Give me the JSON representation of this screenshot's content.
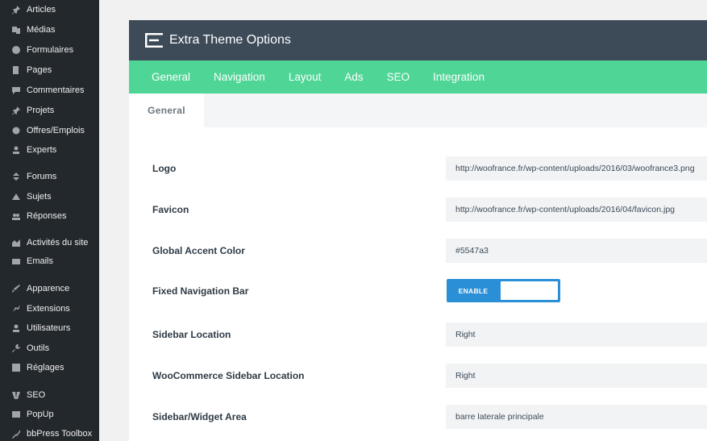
{
  "sidebar": {
    "items": [
      {
        "label": "Articles",
        "icon": "pin-icon"
      },
      {
        "label": "Médias",
        "icon": "media-icon"
      },
      {
        "label": "Formulaires",
        "icon": "form-icon"
      },
      {
        "label": "Pages",
        "icon": "page-icon"
      },
      {
        "label": "Commentaires",
        "icon": "comment-icon"
      },
      {
        "label": "Projets",
        "icon": "pin-icon"
      },
      {
        "label": "Offres/Emplois",
        "icon": "briefcase-icon"
      },
      {
        "label": "Experts",
        "icon": "user-icon"
      },
      {
        "label": "Forums",
        "icon": "forum-icon"
      },
      {
        "label": "Sujets",
        "icon": "topic-icon"
      },
      {
        "label": "Réponses",
        "icon": "reply-icon"
      },
      {
        "label": "Activités du site",
        "icon": "activity-icon"
      },
      {
        "label": "Emails",
        "icon": "email-icon"
      },
      {
        "label": "Apparence",
        "icon": "brush-icon"
      },
      {
        "label": "Extensions",
        "icon": "plugin-icon"
      },
      {
        "label": "Utilisateurs",
        "icon": "users-icon"
      },
      {
        "label": "Outils",
        "icon": "wrench-icon"
      },
      {
        "label": "Réglages",
        "icon": "settings-icon"
      },
      {
        "label": "SEO",
        "icon": "seo-icon"
      },
      {
        "label": "PopUp",
        "icon": "popup-icon"
      },
      {
        "label": "bbPress Toolbox",
        "icon": "toolbox-icon"
      }
    ]
  },
  "header": {
    "title": "Extra Theme Options"
  },
  "tabs": [
    "General",
    "Navigation",
    "Layout",
    "Ads",
    "SEO",
    "Integration"
  ],
  "subtab": "General",
  "settings": [
    {
      "label": "Logo",
      "value": "http://woofrance.fr/wp-content/uploads/2016/03/woofrance3.png"
    },
    {
      "label": "Favicon",
      "value": "http://woofrance.fr/wp-content/uploads/2016/04/favicon.jpg"
    },
    {
      "label": "Global Accent Color",
      "value": "#5547a3"
    },
    {
      "label": "Fixed Navigation Bar",
      "toggle": "ENABLE"
    },
    {
      "label": "Sidebar Location",
      "value": "Right"
    },
    {
      "label": "WooCommerce Sidebar Location",
      "value": "Right"
    },
    {
      "label": "Sidebar/Widget Area",
      "value": "barre laterale principale"
    }
  ],
  "colors": {
    "sidebar": "#23282d",
    "header": "#3d4a58",
    "tabs": "#4fd596",
    "toggle": "#2a8fd6"
  }
}
